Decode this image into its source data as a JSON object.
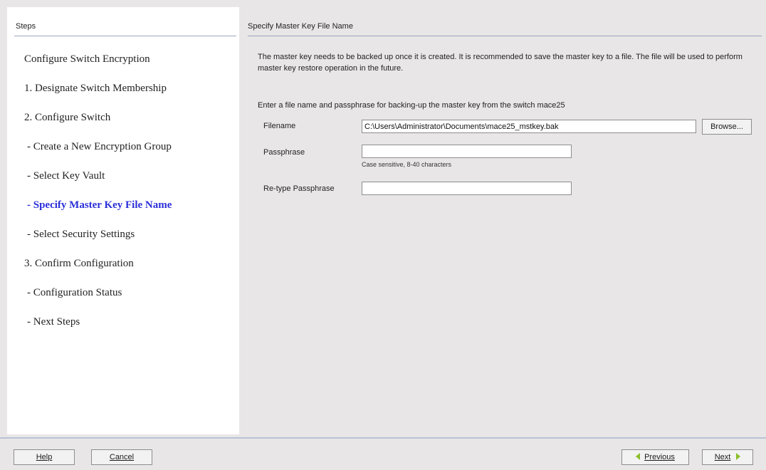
{
  "colors": {
    "background": "#e9e6e7",
    "panel": "#ffffff",
    "active_step": "#2a2ed8",
    "nav_arrow": "#8bbf2a"
  },
  "steps_panel": {
    "title": "Steps",
    "items": [
      {
        "label": "Configure Switch Encryption",
        "active": false
      },
      {
        "label": "1. Designate Switch Membership",
        "active": false
      },
      {
        "label": "2. Configure Switch",
        "active": false
      },
      {
        "label": "- Create a New Encryption Group",
        "active": false
      },
      {
        "label": "- Select Key Vault",
        "active": false
      },
      {
        "label": "- Specify Master Key File Name",
        "active": true
      },
      {
        "label": "- Select Security Settings",
        "active": false
      },
      {
        "label": "3. Confirm Configuration",
        "active": false
      },
      {
        "label": "- Configuration Status",
        "active": false
      },
      {
        "label": "- Next Steps",
        "active": false
      }
    ]
  },
  "main": {
    "title": "Specify Master Key File Name",
    "description": "The master key needs to be backed up once it is created. It is recommended to save the master key to a file. The file will be used to perform master key restore operation in the future.",
    "instruction": "Enter a file name and passphrase for backing-up the master key from the switch mace25",
    "form": {
      "filename_label": "Filename",
      "filename_value": "C:\\Users\\Administrator\\Documents\\mace25_mstkey.bak",
      "browse_label": "Browse...",
      "passphrase_label": "Passphrase",
      "passphrase_value": "",
      "passphrase_hint": "Case sensitive, 8-40 characters",
      "retype_label": "Re-type Passphrase",
      "retype_value": ""
    }
  },
  "footer": {
    "help_label": "Help",
    "cancel_label": "Cancel",
    "previous_label": "Previous",
    "next_label": "Next",
    "previous_icon": "arrow-left-icon",
    "next_icon": "arrow-right-icon"
  }
}
